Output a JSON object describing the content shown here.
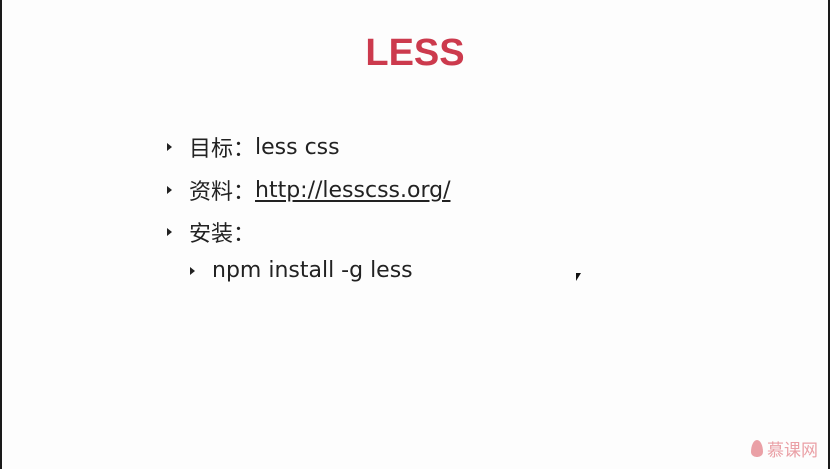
{
  "slide": {
    "title": "LESS",
    "items": [
      {
        "label": "目标：",
        "value": "less css"
      },
      {
        "label": "资料：",
        "link": "http://lesscss.org/"
      },
      {
        "label": "安装："
      },
      {
        "value": "npm install -g less"
      }
    ],
    "title_color": "#cc3a4d"
  },
  "watermark": {
    "text": "慕课网"
  }
}
